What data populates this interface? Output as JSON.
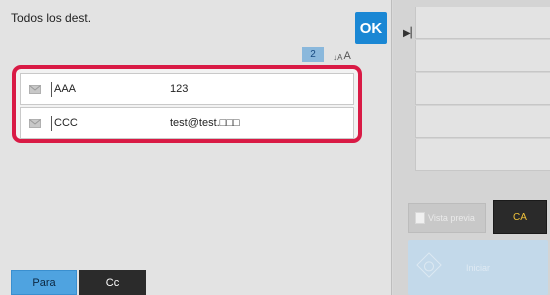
{
  "header": {
    "title": "Todos los dest.",
    "ok_label": "OK"
  },
  "list": {
    "count": "2",
    "sort_label": "A",
    "rows": [
      {
        "name": "AAA",
        "address": "123"
      },
      {
        "name": "CCC",
        "address": "test@test.□□□"
      }
    ]
  },
  "tabs": {
    "to_label": "Para",
    "cc_label": "Cc"
  },
  "right": {
    "preview_label": "Vista previa",
    "ca_label": "CA",
    "start_label": "Iniciar"
  },
  "colors": {
    "accent": "#1a87d4",
    "highlight": "#d91a45",
    "ca_text": "#f0c23a"
  }
}
